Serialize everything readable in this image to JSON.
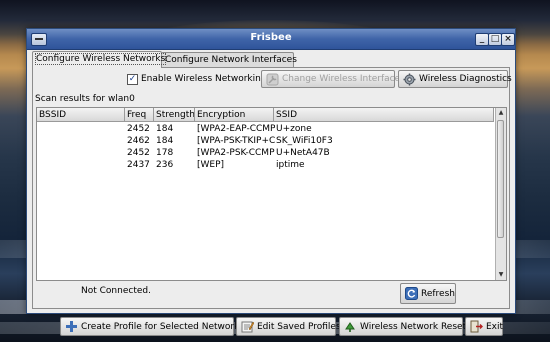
{
  "window": {
    "title": "Frisbee",
    "controls": {
      "minimize": "_",
      "maximize": "□",
      "close": "×"
    }
  },
  "tabs": [
    {
      "label": "Configure Wireless Networks",
      "active": true
    },
    {
      "label": "Configure Network Interfaces",
      "active": false
    }
  ],
  "toolbar": {
    "enable_wireless_label": "Enable Wireless Networking",
    "enable_wireless_checked": true,
    "change_interface_label": "Change Wireless Interface",
    "change_interface_enabled": false,
    "diagnostics_label": "Wireless Diagnostics"
  },
  "scan": {
    "label": "Scan results for wlan0",
    "columns": [
      "BSSID",
      "Freq",
      "Strength",
      "Encryption",
      "SSID"
    ],
    "rows": [
      {
        "bssid": "",
        "freq": "2452",
        "strength": "184",
        "encryption": "[WPA2-EAP-CCMP",
        "ssid": "U+zone"
      },
      {
        "bssid": "",
        "freq": "2462",
        "strength": "184",
        "encryption": "[WPA-PSK-TKIP+C",
        "ssid": "SK_WiFi10F3"
      },
      {
        "bssid": "",
        "freq": "2452",
        "strength": "178",
        "encryption": "[WPA2-PSK-CCMP",
        "ssid": "U+NetA47B"
      },
      {
        "bssid": "",
        "freq": "2437",
        "strength": "236",
        "encryption": "[WEP]",
        "ssid": "iptime"
      }
    ]
  },
  "status": {
    "text": "Not Connected."
  },
  "buttons": {
    "refresh": "Refresh",
    "create_profile": "Create Profile for Selected Network",
    "edit_profiles": "Edit Saved Profiles",
    "network_reset": "Wireless Network Reset",
    "exit": "Exit"
  },
  "icons": {
    "change_interface": "wrench-icon",
    "diagnostics": "gear-icon",
    "refresh": "refresh-icon",
    "create_profile": "plus-icon",
    "edit_profiles": "edit-icon",
    "network_reset": "reset-icon",
    "exit": "exit-icon"
  },
  "colors": {
    "titlebar": "#3f64a8",
    "window_bg": "#ededed",
    "accent": "#1a5fb4"
  }
}
